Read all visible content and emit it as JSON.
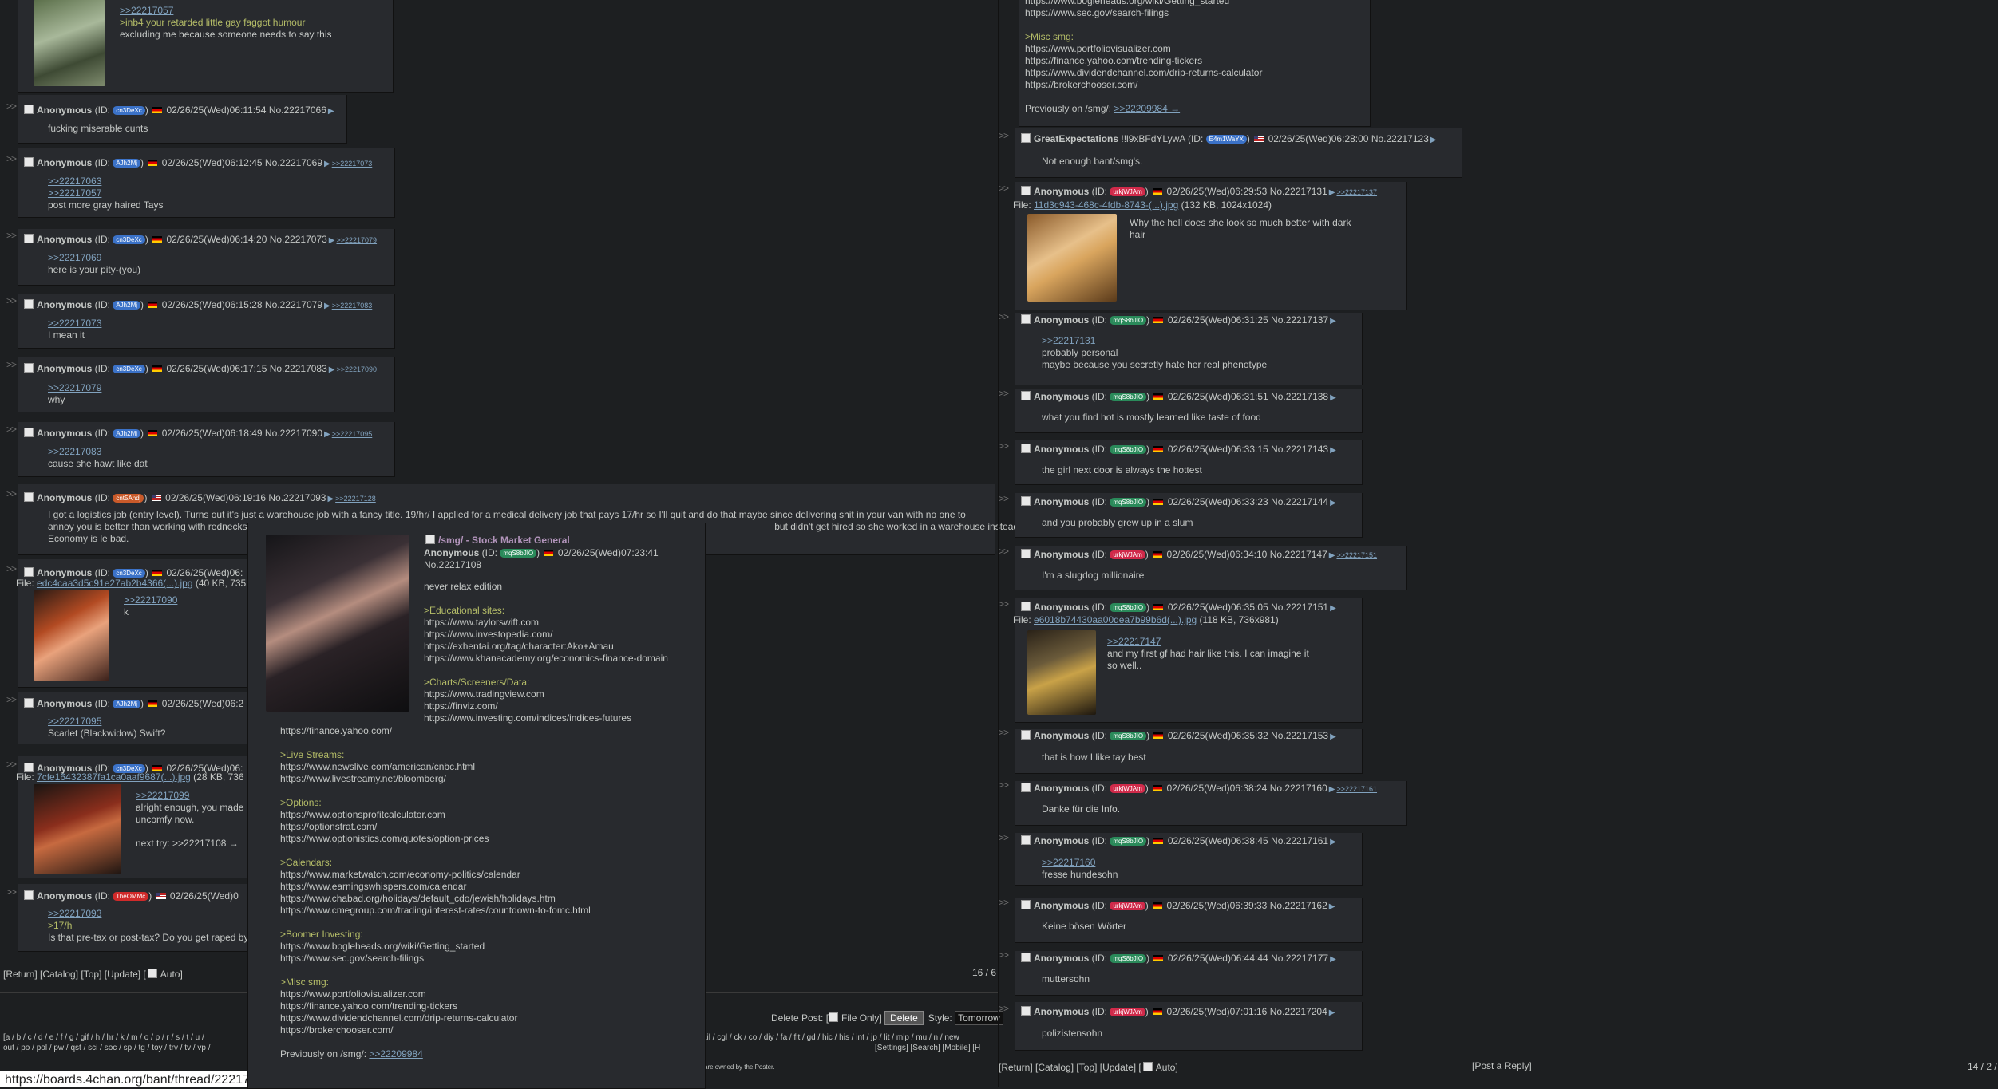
{
  "left": {
    "top_post": {
      "links": [
        ">>22217057"
      ],
      "lines": [
        {
          "t": ">inb4 your retarded little gay faggot humour",
          "g": true
        },
        {
          "t": "excluding me because someone needs to say this",
          "g": false
        }
      ]
    },
    "posts": [
      {
        "name": "Anonymous",
        "id": "cn3DeXc",
        "idc": "#3b72c8",
        "flag": "de",
        "dt": "02/26/25(Wed)06:11:54",
        "no": "No.22217066",
        "backlinks": [],
        "links": [],
        "lines": [
          {
            "t": "fucking miserable cunts",
            "g": false
          }
        ]
      },
      {
        "name": "Anonymous",
        "id": "AJh2Mj",
        "idc": "#3b72c8",
        "flag": "de",
        "dt": "02/26/25(Wed)06:12:45",
        "no": "No.22217069",
        "backlinks": [
          ">>22217073"
        ],
        "links": [
          ">>22217063",
          ">>22217057"
        ],
        "lines": [
          {
            "t": "post more gray haired Tays",
            "g": false
          }
        ]
      },
      {
        "name": "Anonymous",
        "id": "cn3DeXc",
        "idc": "#3b72c8",
        "flag": "de",
        "dt": "02/26/25(Wed)06:14:20",
        "no": "No.22217073",
        "backlinks": [
          ">>22217079"
        ],
        "links": [
          ">>22217069"
        ],
        "lines": [
          {
            "t": "here is your pity-(you)",
            "g": false
          }
        ]
      },
      {
        "name": "Anonymous",
        "id": "AJh2Mj",
        "idc": "#3b72c8",
        "flag": "de",
        "dt": "02/26/25(Wed)06:15:28",
        "no": "No.22217079",
        "backlinks": [
          ">>22217083"
        ],
        "links": [
          ">>22217073"
        ],
        "lines": [
          {
            "t": "I mean it",
            "g": false
          }
        ]
      },
      {
        "name": "Anonymous",
        "id": "cn3DeXc",
        "idc": "#3b72c8",
        "flag": "de",
        "dt": "02/26/25(Wed)06:17:15",
        "no": "No.22217083",
        "backlinks": [
          ">>22217090"
        ],
        "links": [
          ">>22217079"
        ],
        "lines": [
          {
            "t": "why",
            "g": false
          }
        ]
      },
      {
        "name": "Anonymous",
        "id": "AJh2Mj",
        "idc": "#3b72c8",
        "flag": "de",
        "dt": "02/26/25(Wed)06:18:49",
        "no": "No.22217090",
        "backlinks": [
          ">>22217095"
        ],
        "links": [
          ">>22217083"
        ],
        "lines": [
          {
            "t": "cause she hawt like dat",
            "g": false
          }
        ]
      },
      {
        "name": "Anonymous",
        "id": "cnt5Ahdj",
        "idc": "#c95a2a",
        "flag": "us",
        "dt": "02/26/25(Wed)06:19:16",
        "no": "No.22217093",
        "backlinks": [
          ">>22217128"
        ],
        "links": [],
        "lines": [
          {
            "t": "I got a logistics job (entry level). Turns out it's just a warehouse job with a fancy title. 19/hr/ I applied for a medical delivery job that pays 17/hr so I'll quit and do that maybe since delivering shit in your van with no one to",
            "g": false
          },
          {
            "t": "annoy you is better than working with rednecks. File: 2c72fa66f53619d3230b11f5620483a2.jpg (76 KB, 736x918)                                                                                             but didn't get hired so she worked in a warehouse instead.",
            "g": false
          },
          {
            "t": "Economy is le bad.",
            "g": false
          }
        ]
      },
      {
        "name": "Anonymous",
        "id": "cn3DeXc",
        "idc": "#3b72c8",
        "flag": "de",
        "dt": "02/26/25(Wed)06:",
        "no": "",
        "file": "edc4caa3d5c91e27ab2b4366(...).jpg",
        "fmeta": "(40 KB, 735",
        "links": [
          ">>22217090"
        ],
        "lines": [
          {
            "t": "k",
            "g": false
          }
        ]
      },
      {
        "name": "Anonymous",
        "id": "AJh2Mj",
        "idc": "#3b72c8",
        "flag": "de",
        "dt": "02/26/25(Wed)06:2",
        "no": "",
        "links": [
          ">>22217095"
        ],
        "lines": [
          {
            "t": "Scarlet (Blackwidow) Swift?",
            "g": false
          }
        ]
      },
      {
        "name": "Anonymous",
        "id": "cn3DeXc",
        "idc": "#3b72c8",
        "flag": "de",
        "dt": "02/26/25(Wed)06:",
        "no": "",
        "file": "7cfe16432387fa1ca0aaf9687(...).jpg",
        "fmeta": "(28 KB, 736",
        "links": [
          ">>22217099"
        ],
        "lines": [
          {
            "t": "alright enough, you made i",
            "g": false
          },
          {
            "t": "uncomfy now.",
            "g": false
          },
          {
            "t": "",
            "g": false
          },
          {
            "t": "next try: >>22217108 →",
            "g": false
          }
        ]
      },
      {
        "name": "Anonymous",
        "id": "1heOMMc",
        "idc": "#d02a2a",
        "flag": "us",
        "dt": "02/26/25(Wed)0",
        "no": "",
        "links": [
          ">>22217093"
        ],
        "lines": [
          {
            "t": ">17/h",
            "g": true
          },
          {
            "t": "Is that pre-tax or post-tax? Do you get raped by",
            "g": false
          }
        ]
      }
    ],
    "bottom_nav": "[Return] [Catalog] [Top] [Update] [",
    "auto_label": "Auto]",
    "page_count": "16 / 6",
    "delete_label": "Delete Post: [",
    "file_only_label": "File Only]",
    "delete_btn": "Delete",
    "style_label": "Style:",
    "style_value": "Tomorrow",
    "boards1": "[a / b / c / d / e / f / g / gif / h / hr / k / m / o / p / r / s / t / u /",
    "boards2": "out / po / pol / pw / qst / sci / soc / sp / tg / toy / trv / tv / vp /",
    "boards3": "ail / cgl / ck / co / diy / fa / fit / gd / hic / his / int / jp / lit / mlp / mu / n / new",
    "settings_links": "[Settings] [Search] [Mobile] [H",
    "owned_text": "are owned by the Poster.",
    "status_url": "https://boards.4chan.org/bant/thread/22217108#p22217108"
  },
  "hover": {
    "subject": "/smg/ - Stock Market General",
    "name": "Anonymous",
    "id": "mqS8bJIO",
    "dt": "02/26/25(Wed)07:23:41",
    "no": "No.22217108",
    "blocks": [
      {
        "lines": [
          "never relax edition"
        ]
      },
      {
        "head": ">Educational sites:",
        "lines": [
          "https://www.taylorswift.com",
          "https://www.investopedia.com/",
          "https://exhentai.org/tag/character:Ako+Amau",
          "https://www.khanacademy.org/economics-finance-domain"
        ]
      },
      {
        "head": ">Charts/Screeners/Data:",
        "lines": [
          "https://www.tradingview.com",
          "https://finviz.com/",
          "https://www.investing.com/indices/indices-futures"
        ]
      }
    ],
    "blocks2": [
      {
        "lines": [
          "https://finance.yahoo.com/"
        ]
      },
      {
        "head": ">Live Streams:",
        "lines": [
          "https://www.newslive.com/american/cnbc.html",
          "https://www.livestreamy.net/bloomberg/"
        ]
      },
      {
        "head": ">Options:",
        "lines": [
          "https://www.optionsprofitcalculator.com",
          "https://optionstrat.com/",
          "https://www.optionistics.com/quotes/option-prices"
        ]
      },
      {
        "head": ">Calendars:",
        "lines": [
          "https://www.marketwatch.com/economy-politics/calendar",
          "https://www.earningswhispers.com/calendar",
          "https://www.chabad.org/holidays/default_cdo/jewish/holidays.htm",
          "https://www.cmegroup.com/trading/interest-rates/countdown-to-fomc.html"
        ]
      },
      {
        "head": ">Boomer Investing:",
        "lines": [
          "https://www.bogleheads.org/wiki/Getting_started",
          "https://www.sec.gov/search-filings"
        ]
      },
      {
        "head": ">Misc smg:",
        "lines": [
          "https://www.portfoliovisualizer.com",
          "https://finance.yahoo.com/trending-tickers",
          "https://www.dividendchannel.com/drip-returns-calculator",
          "https://brokerchooser.com/"
        ]
      }
    ],
    "prev_label": "Previously on /smg/:",
    "prev_link": ">>22209984"
  },
  "right": {
    "op_tail": [
      "https://www.bogleheads.org/wiki/Getting_started",
      "https://www.sec.gov/search-filings"
    ],
    "misc_head": ">Misc smg:",
    "misc": [
      "https://www.portfoliovisualizer.com",
      "https://finance.yahoo.com/trending-tickers",
      "https://www.dividendchannel.com/drip-returns-calculator",
      "https://brokerchooser.com/"
    ],
    "prev_label": "Previously on /smg/:",
    "prev_link": ">>22209984 →",
    "posts": [
      {
        "name": "GreatExpectations",
        "trip": "!!l9xBFdYLywA",
        "id": "E4m1WaYX",
        "idc": "#3b72c8",
        "flag": "us",
        "dt": "02/26/25(Wed)06:28:00",
        "no": "No.22217123",
        "backlinks": [],
        "links": [],
        "lines": [
          {
            "t": "Not enough bant/smg's.",
            "g": false
          }
        ]
      },
      {
        "name": "Anonymous",
        "trip": "",
        "id": "urkjWJAm",
        "idc": "#d02a4a",
        "flag": "de",
        "dt": "02/26/25(Wed)06:29:53",
        "no": "No.22217131",
        "backlinks": [
          ">>22217137"
        ],
        "file": "11d3c943-468c-4fdb-8743-(...).jpg",
        "fmeta": "(132 KB, 1024x1024)",
        "links": [],
        "lines": [
          {
            "t": "Why the hell does she look so much better with dark",
            "g": false
          },
          {
            "t": "hair",
            "g": false
          }
        ]
      },
      {
        "name": "Anonymous",
        "trip": "",
        "id": "mqS8bJIO",
        "idc": "#2a8a5a",
        "flag": "de",
        "dt": "02/26/25(Wed)06:31:25",
        "no": "No.22217137",
        "backlinks": [],
        "links": [
          ">>22217131"
        ],
        "lines": [
          {
            "t": "probably personal",
            "g": false
          },
          {
            "t": "maybe because you secretly hate her real phenotype",
            "g": false
          }
        ]
      },
      {
        "name": "Anonymous",
        "trip": "",
        "id": "mqS8bJIO",
        "idc": "#2a8a5a",
        "flag": "de",
        "dt": "02/26/25(Wed)06:31:51",
        "no": "No.22217138",
        "backlinks": [],
        "links": [],
        "lines": [
          {
            "t": "what you find hot is mostly learned like taste of food",
            "g": false
          }
        ]
      },
      {
        "name": "Anonymous",
        "trip": "",
        "id": "mqS8bJIO",
        "idc": "#2a8a5a",
        "flag": "de",
        "dt": "02/26/25(Wed)06:33:15",
        "no": "No.22217143",
        "backlinks": [],
        "links": [],
        "lines": [
          {
            "t": "the girl next door is always the hottest",
            "g": false
          }
        ]
      },
      {
        "name": "Anonymous",
        "trip": "",
        "id": "mqS8bJIO",
        "idc": "#2a8a5a",
        "flag": "de",
        "dt": "02/26/25(Wed)06:33:23",
        "no": "No.22217144",
        "backlinks": [],
        "links": [],
        "lines": [
          {
            "t": "and you probably grew up in a slum",
            "g": false
          }
        ]
      },
      {
        "name": "Anonymous",
        "trip": "",
        "id": "urkjWJAm",
        "idc": "#d02a4a",
        "flag": "de",
        "dt": "02/26/25(Wed)06:34:10",
        "no": "No.22217147",
        "backlinks": [
          ">>22217151"
        ],
        "links": [],
        "lines": [
          {
            "t": "I'm a slugdog millionaire",
            "g": false
          }
        ]
      },
      {
        "name": "Anonymous",
        "trip": "",
        "id": "mqS8bJIO",
        "idc": "#2a8a5a",
        "flag": "de",
        "dt": "02/26/25(Wed)06:35:05",
        "no": "No.22217151",
        "backlinks": [],
        "file": "e6018b74430aa00dea7b99b6d(...).jpg",
        "fmeta": "(118 KB, 736x981)",
        "links": [
          ">>22217147"
        ],
        "lines": [
          {
            "t": "and my first gf had hair like this. I can imagine it",
            "g": false
          },
          {
            "t": "so well..",
            "g": false
          }
        ]
      },
      {
        "name": "Anonymous",
        "trip": "",
        "id": "mqS8bJIO",
        "idc": "#2a8a5a",
        "flag": "de",
        "dt": "02/26/25(Wed)06:35:32",
        "no": "No.22217153",
        "backlinks": [],
        "links": [],
        "lines": [
          {
            "t": "that is how I like tay best",
            "g": false
          }
        ]
      },
      {
        "name": "Anonymous",
        "trip": "",
        "id": "urkjWJAm",
        "idc": "#d02a4a",
        "flag": "de",
        "dt": "02/26/25(Wed)06:38:24",
        "no": "No.22217160",
        "backlinks": [
          ">>22217161"
        ],
        "links": [],
        "lines": [
          {
            "t": "Danke für die Info.",
            "g": false
          }
        ]
      },
      {
        "name": "Anonymous",
        "trip": "",
        "id": "mqS8bJIO",
        "idc": "#2a8a5a",
        "flag": "de",
        "dt": "02/26/25(Wed)06:38:45",
        "no": "No.22217161",
        "backlinks": [],
        "links": [
          ">>22217160"
        ],
        "lines": [
          {
            "t": "fresse hundesohn",
            "g": false
          }
        ]
      },
      {
        "name": "Anonymous",
        "trip": "",
        "id": "urkjWJAm",
        "idc": "#d02a4a",
        "flag": "de",
        "dt": "02/26/25(Wed)06:39:33",
        "no": "No.22217162",
        "backlinks": [],
        "links": [],
        "lines": [
          {
            "t": "Keine bösen Wörter",
            "g": false
          }
        ]
      },
      {
        "name": "Anonymous",
        "trip": "",
        "id": "mqS8bJIO",
        "idc": "#2a8a5a",
        "flag": "de",
        "dt": "02/26/25(Wed)06:44:44",
        "no": "No.22217177",
        "backlinks": [],
        "links": [],
        "lines": [
          {
            "t": "muttersohn",
            "g": false
          }
        ]
      },
      {
        "name": "Anonymous",
        "trip": "",
        "id": "urkjWJAm",
        "idc": "#d02a4a",
        "flag": "de",
        "dt": "02/26/25(Wed)07:01:16",
        "no": "No.22217204",
        "backlinks": [],
        "links": [],
        "lines": [
          {
            "t": "polizistensohn",
            "g": false
          }
        ]
      }
    ],
    "bottom_nav": "[Return] [Catalog] [Top] [Update] [",
    "auto_label": "Auto]",
    "post_reply": "[Post a Reply]",
    "page_count": "14 / 2 /"
  }
}
